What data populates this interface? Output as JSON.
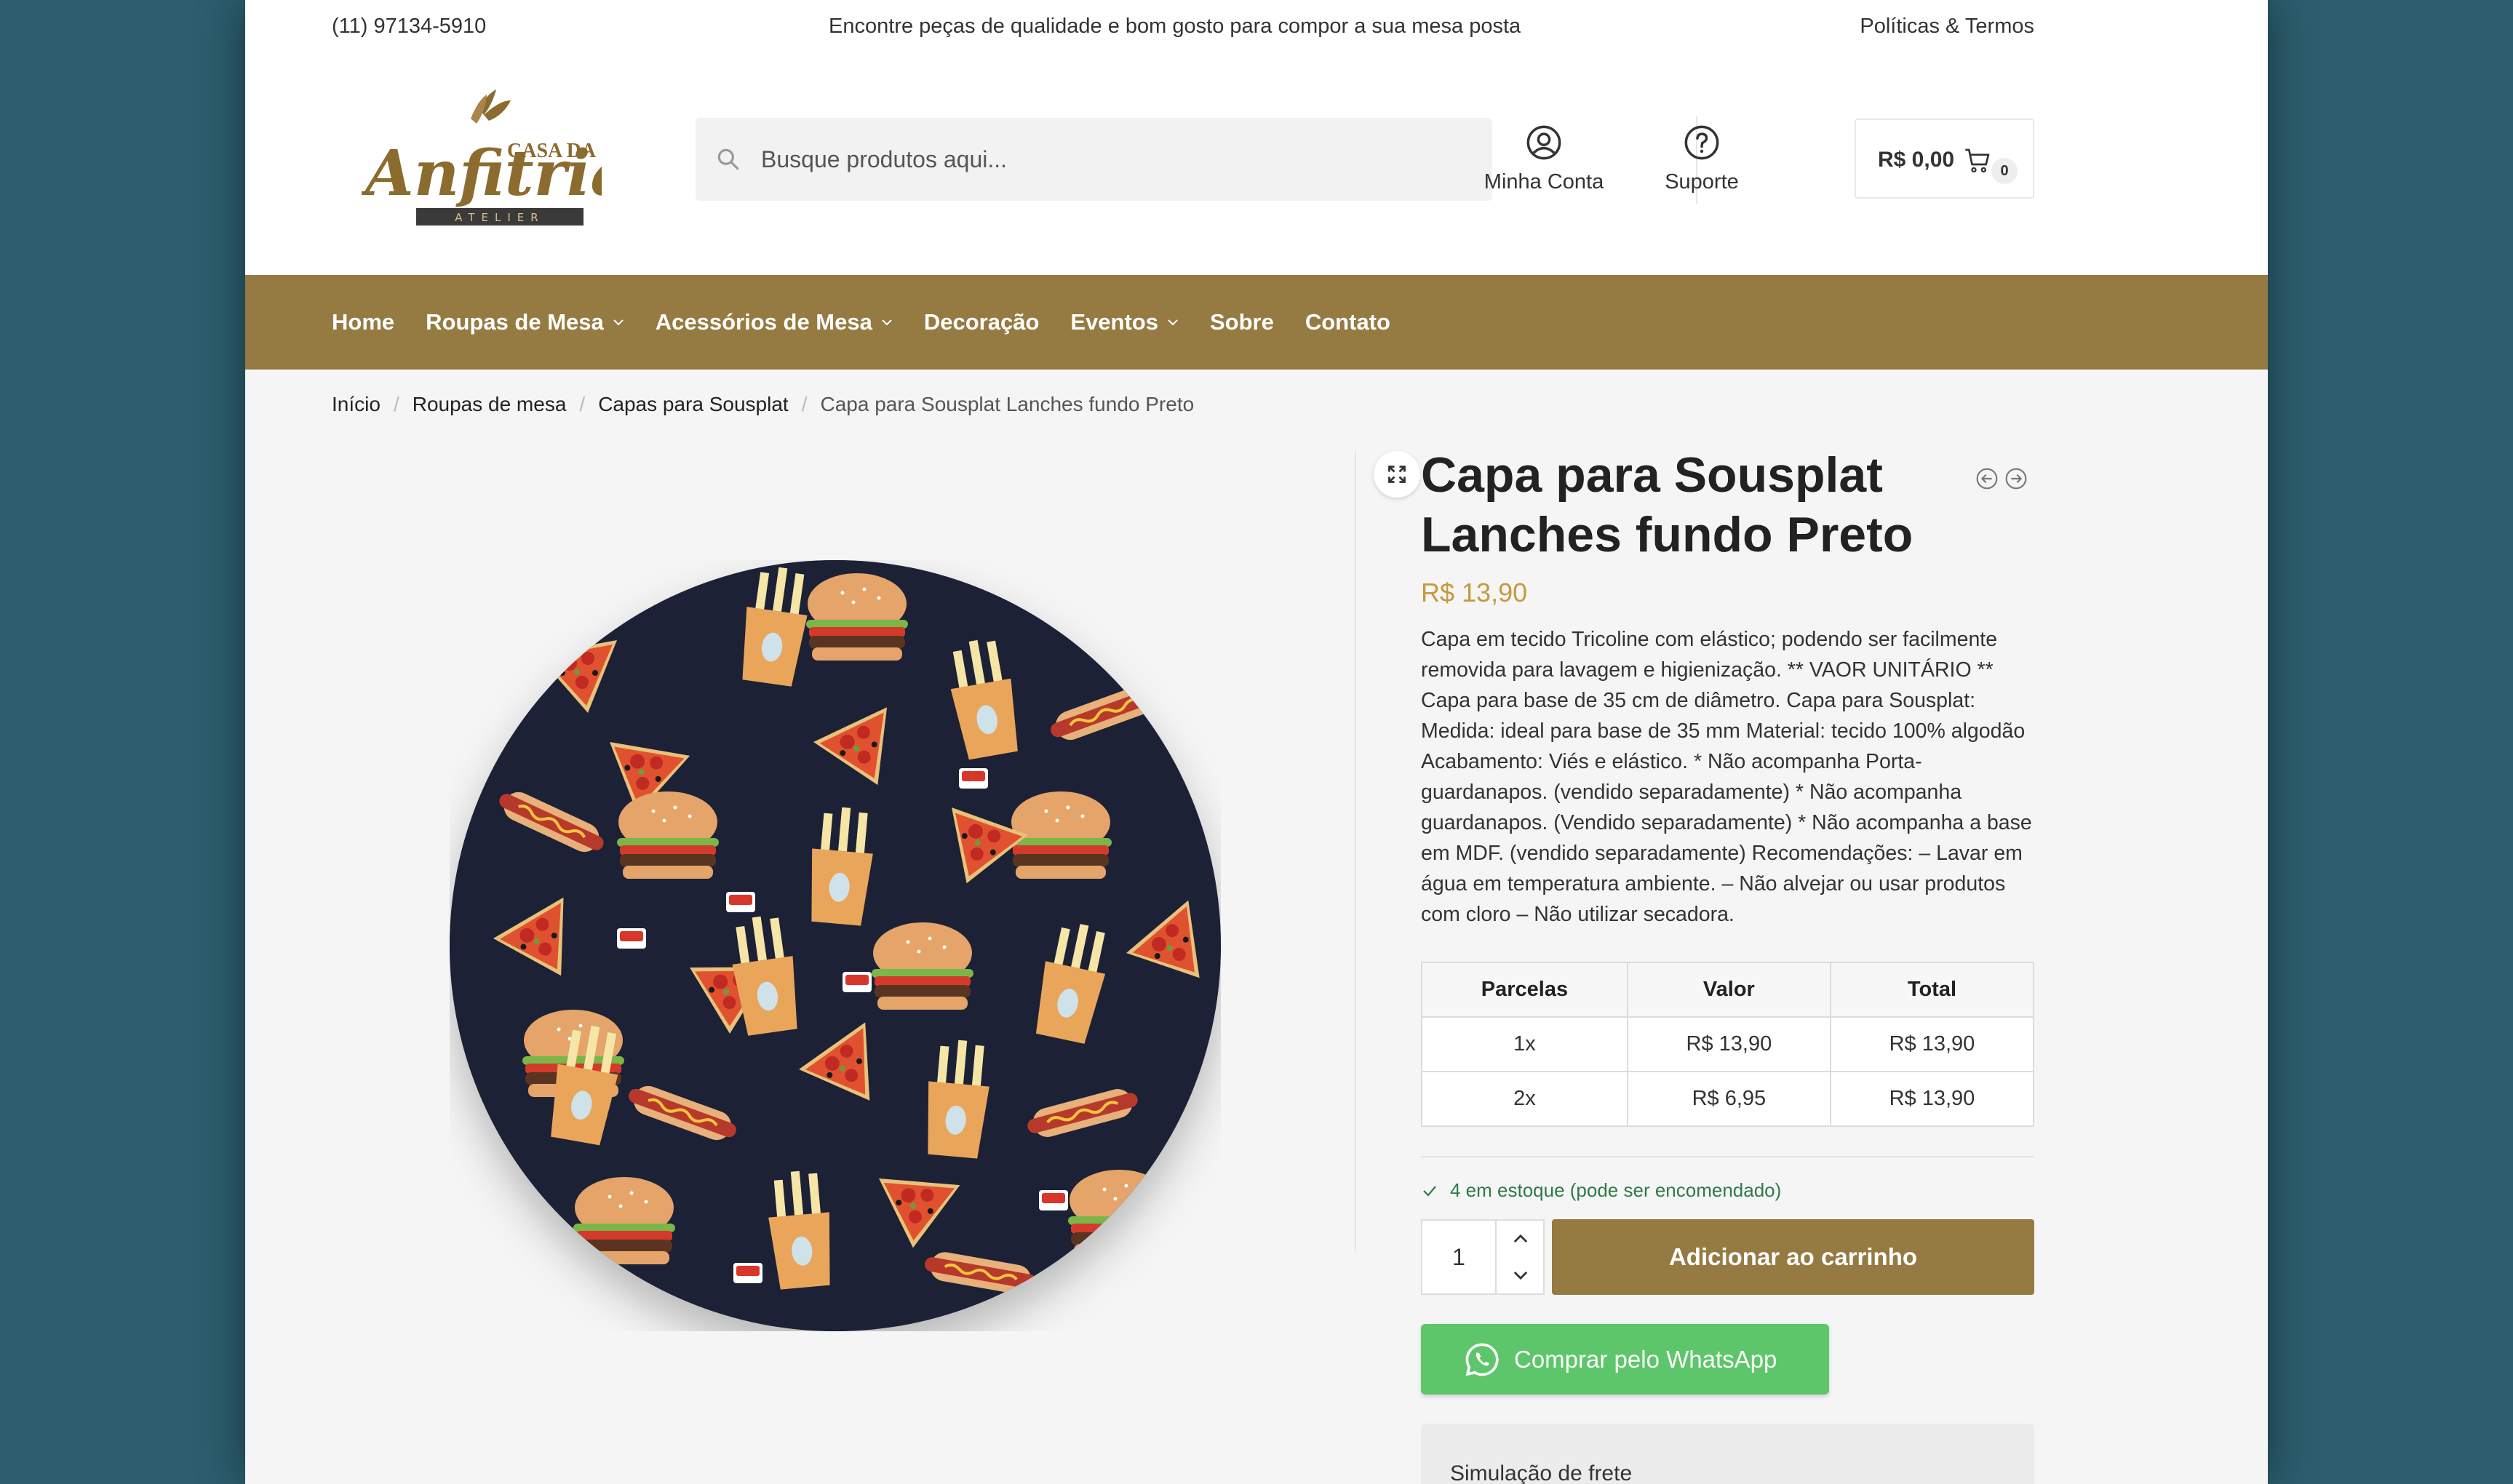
{
  "topbar": {
    "phone": "(11) 97134-5910",
    "tagline": "Encontre peças de qualidade e bom gosto para compor a sua mesa posta",
    "policies": "Políticas & Termos"
  },
  "logo": {
    "line1": "CASA DA",
    "line2": "Anfitriã",
    "line3": "ATELIER",
    "brand_color": "#8b6b2e"
  },
  "search": {
    "placeholder": "Busque produtos aqui..."
  },
  "header": {
    "account_label": "Minha Conta",
    "support_label": "Suporte",
    "cart_total": "R$ 0,00",
    "cart_count": "0"
  },
  "nav": {
    "items": [
      {
        "label": "Home"
      },
      {
        "label": "Roupas de Mesa"
      },
      {
        "label": "Acessórios de Mesa"
      },
      {
        "label": "Decoração"
      },
      {
        "label": "Eventos"
      },
      {
        "label": "Sobre"
      },
      {
        "label": "Contato"
      }
    ],
    "bg_color": "#957b42"
  },
  "breadcrumb": [
    "Início",
    "Roupas de mesa",
    "Capas para Sousplat",
    "Capa para Sousplat Lanches fundo Preto"
  ],
  "product": {
    "title": "Capa para Sousplat Lanches fundo Preto",
    "price": "R$ 13,90",
    "price_color": "#c49a3d",
    "description": "Capa em tecido Tricoline com elástico; podendo ser facilmente removida para lavagem e higienização. ** VAOR UNITÁRIO ** Capa para base de 35 cm de diâmetro. Capa para Sousplat: Medida: ideal para base de 35 mm Material: tecido 100% algodão Acabamento: Viés e elástico. * Não acompanha Porta-guardanapos. (vendido separadamente) * Não acompanha guardanapos. (Vendido separadamente) * Não acompanha a base em MDF. (vendido separadamente) Recomendações: – Lavar em água em temperatura ambiente. – Não alvejar ou usar produtos com cloro – Não utilizar secadora.",
    "installments": {
      "headers": [
        "Parcelas",
        "Valor",
        "Total"
      ],
      "rows": [
        [
          "1x",
          "R$ 13,90",
          "R$ 13,90"
        ],
        [
          "2x",
          "R$ 6,95",
          "R$ 13,90"
        ]
      ]
    },
    "stock": "4 em estoque (pode ser encomendado)",
    "quantity": "1",
    "add_to_cart": "Adicionar ao carrinho",
    "whatsapp": "Comprar pelo WhatsApp",
    "whatsapp_color": "#5dc66a",
    "shipping_title": "Simulação de frete"
  },
  "icons": {
    "search": "search-icon",
    "account": "user-circle-icon",
    "support": "help-circle-icon",
    "cart": "cart-icon",
    "zoom": "expand-icon",
    "prev": "arrow-left-circle-icon",
    "next": "arrow-right-circle-icon",
    "check": "check-icon",
    "whatsapp": "whatsapp-icon"
  }
}
